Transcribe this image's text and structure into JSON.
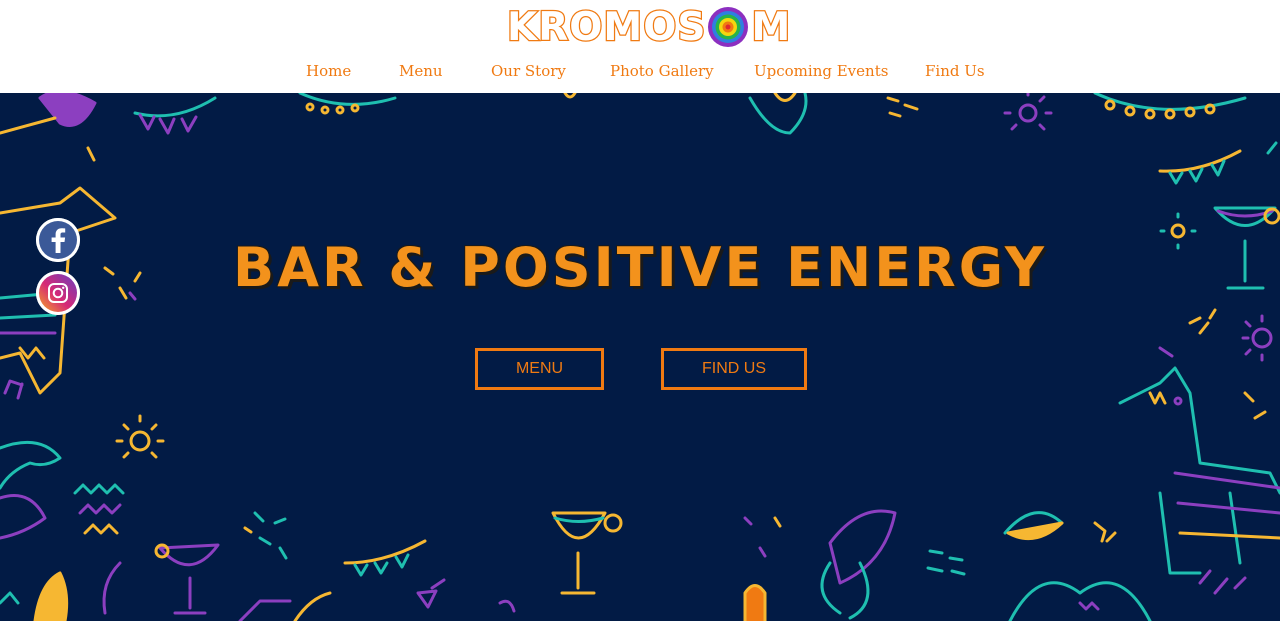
{
  "brand": {
    "logo_text_start": "KROMOS",
    "logo_text_end": "M"
  },
  "nav": {
    "items": [
      {
        "label": "Home"
      },
      {
        "label": "Menu"
      },
      {
        "label": "Our Story"
      },
      {
        "label": "Photo Gallery"
      },
      {
        "label": "Upcoming Events"
      },
      {
        "label": "Find Us"
      }
    ]
  },
  "social": {
    "facebook_icon": "facebook-icon",
    "instagram_icon": "instagram-icon"
  },
  "hero": {
    "headline": "BAR & POSITIVE ENERGY",
    "menu_button": "MENU",
    "find_us_button": "FIND US"
  },
  "colors": {
    "accent": "#f07a12",
    "hero_background": "#021b45",
    "decor_teal": "#1fbfb0",
    "decor_purple": "#8c3fc0",
    "decor_yellow": "#f6b732"
  }
}
